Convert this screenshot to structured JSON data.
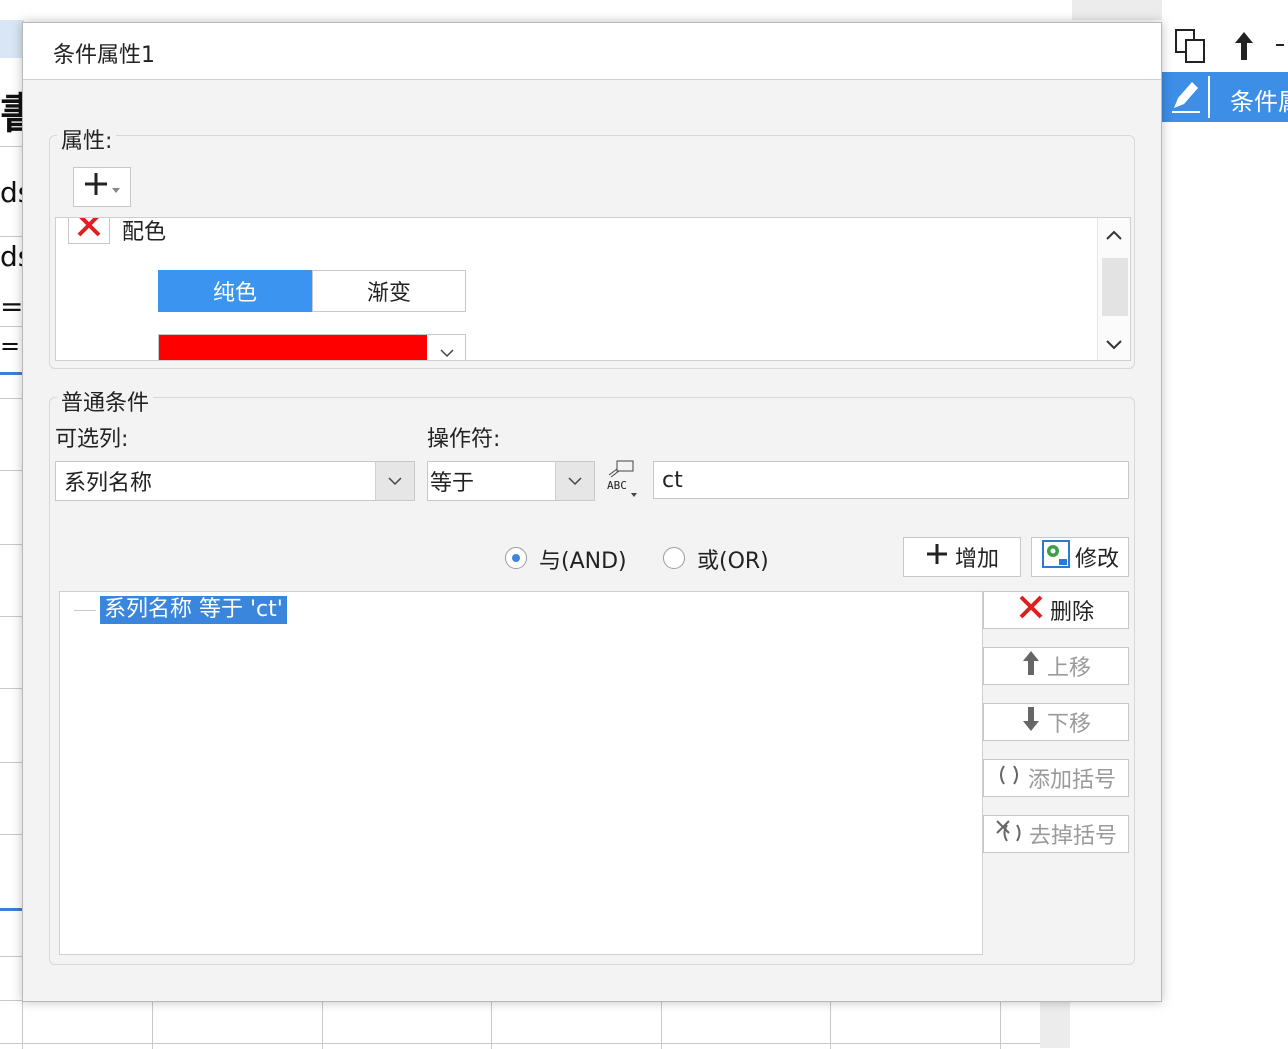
{
  "background": {
    "left_fragments": [
      "書",
      "ds",
      "ds",
      "=",
      "=m"
    ],
    "right_panel_label": "条件属"
  },
  "dialog": {
    "title": "条件属性1",
    "attributes": {
      "legend": "属性:",
      "add_button_label": "+",
      "property_name": "配色",
      "color_mode": {
        "options": [
          "纯色",
          "渐变"
        ],
        "selected": "纯色"
      },
      "color_value": "#ff0000"
    },
    "condition": {
      "legend": "普通条件",
      "column_label": "可选列:",
      "column_value": "系列名称",
      "operator_label": "操作符:",
      "operator_value": "等于",
      "value_input": "ct",
      "logic_and_label": "与(AND)",
      "logic_or_label": "或(OR)",
      "logic_selected": "AND",
      "add_label": "增加",
      "modify_label": "修改",
      "delete_label": "删除",
      "move_up_label": "上移",
      "move_down_label": "下移",
      "add_bracket_label": "添加括号",
      "remove_bracket_label": "去掉括号",
      "tree_items": [
        "系列名称 等于 'ct'"
      ]
    }
  }
}
